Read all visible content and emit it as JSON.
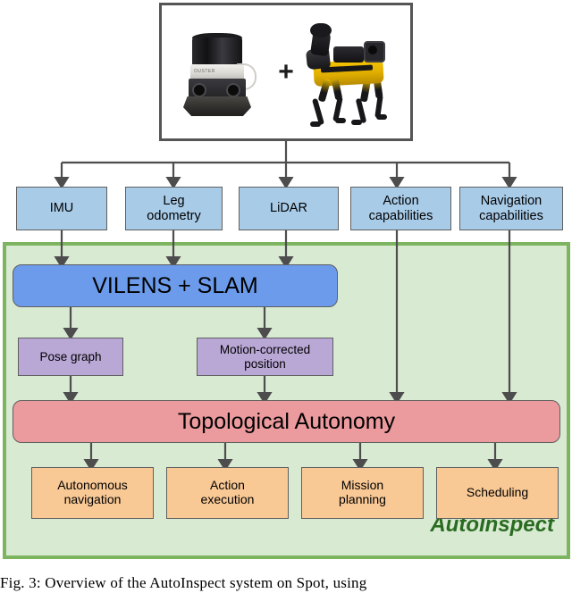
{
  "figure": {
    "caption": "Fig. 3: Overview of the AutoInspect system on Spot, using",
    "system_label": "AutoInspect"
  },
  "photo_panel": {
    "plus": "+",
    "lidar_label": "lidar-sensor-photo",
    "lidar_band_text": "OUSTER",
    "robot_label": "spot-quadruped-robot-photo"
  },
  "inputs": [
    {
      "id": "imu",
      "label": "IMU"
    },
    {
      "id": "leg-odometry",
      "label": "Leg\nodometry"
    },
    {
      "id": "lidar",
      "label": "LiDAR"
    },
    {
      "id": "action-capabilities",
      "label": "Action\ncapabilities"
    },
    {
      "id": "navigation-capabilities",
      "label": "Navigation\ncapabilities"
    }
  ],
  "estimation": {
    "label": "VILENS + SLAM"
  },
  "intermediates": [
    {
      "id": "pose-graph",
      "label": "Pose graph"
    },
    {
      "id": "motion-corrected-position",
      "label": "Motion-corrected\nposition"
    }
  ],
  "autonomy": {
    "label": "Topological Autonomy"
  },
  "outputs": [
    {
      "id": "autonomous-navigation",
      "label": "Autonomous\nnavigation"
    },
    {
      "id": "action-execution",
      "label": "Action\nexecution"
    },
    {
      "id": "mission-planning",
      "label": "Mission\nplanning"
    },
    {
      "id": "scheduling",
      "label": "Scheduling"
    }
  ],
  "colors": {
    "input_box": "#a8cbe8",
    "estimation_box": "#6b9bea",
    "intermediate_box": "#b9a7d6",
    "autonomy_box": "#eb9a9e",
    "output_box": "#f8c895",
    "container_fill": "#d9ead3",
    "container_border": "#7cb45f",
    "label_text": "#2a6b22",
    "arrow": "#4d4d4d",
    "node_border": "#5f5f5f"
  }
}
